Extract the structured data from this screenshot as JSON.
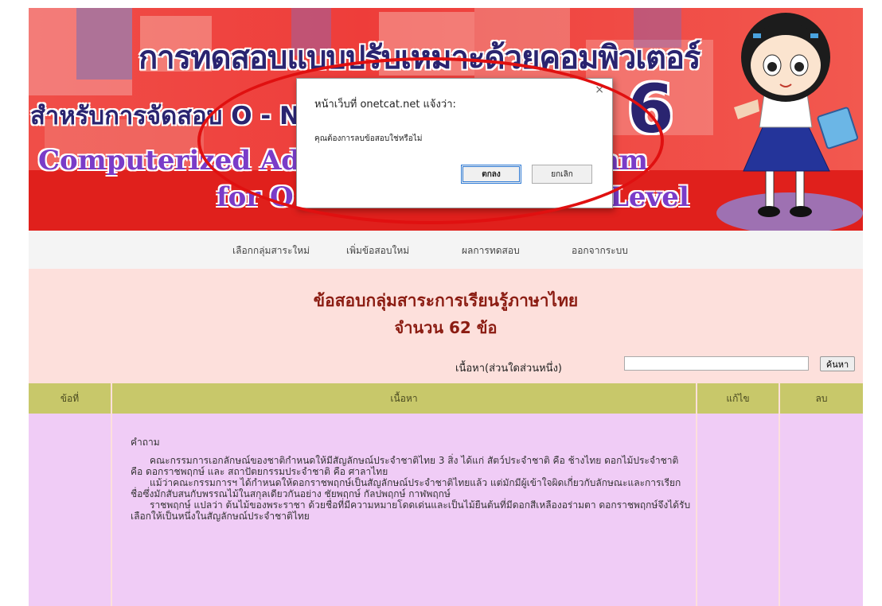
{
  "banner": {
    "title_th": "การทดสอบแบบปรับเหมาะด้วยคอมพิวเตอร์",
    "subtitle_th": "สำหรับการจัดสอบ O - N",
    "grade_number": "6",
    "english_line1_start": "Computerized Ad",
    "english_line1_end": "am",
    "english_line2_start": "for O",
    "english_line2_end": "Level"
  },
  "nav": {
    "items": [
      "เลือกกลุ่มสาระใหม่",
      "เพิ่มข้อสอบใหม่",
      "ผลการทดสอบ",
      "ออกจากระบบ"
    ]
  },
  "main": {
    "heading": "ข้อสอบกลุ่มสาระการเรียนรู้ภาษาไทย",
    "count_line": "จำนวน 62 ข้อ",
    "search_label": "เนื้อหา(ส่วนใดส่วนหนึ่ง)",
    "search_value": "",
    "search_button": "ค้นหา"
  },
  "table": {
    "headers": [
      "ข้อที่",
      "เนื้อหา",
      "แก้ไข",
      "ลบ"
    ],
    "row": {
      "title": "คำถาม",
      "paragraphs": [
        "คณะกรรมการเอกลักษณ์ของชาติกำหนดให้มีสัญลักษณ์ประจำชาติไทย 3 สิ่ง ได้แก่ สัตว์ประจำชาติ คือ ช้างไทย ดอกไม้ประจำชาติ คือ ดอกราชพฤกษ์ และ สถาปัตยกรรมประจำชาติ คือ ศาลาไทย",
        "แม้ว่าคณะกรรมการฯ ได้กำหนดให้ดอกราชพฤกษ์เป็นสัญลักษณ์ประจำชาติไทยแล้ว แต่มักมีผู้เข้าใจผิดเกี่ยวกับลักษณะและการเรียกชื่อซึ่งมักสับสนกับพรรณไม้ในสกุลเดียวกันอย่าง ชัยพฤกษ์ กัลปพฤกษ์ กาฬพฤกษ์",
        "ราชพฤกษ์ แปลว่า ต้นไม้ของพระราชา ด้วยชื่อที่มีความหมายโดดเด่นและเป็นไม้ยืนต้นที่มีดอกสีเหลืองอร่ามตา ดอกราชพฤกษ์จึงได้รับเลือกให้เป็นหนึ่งในสัญลักษณ์ประจำชาติไทย"
      ]
    }
  },
  "dialog": {
    "title": "หน้าเว็บที่ onetcat.net แจ้งว่า:",
    "message": "คุณต้องการลบข้อสอบใช่หรือไม่",
    "ok_label": "ตกลง",
    "cancel_label": "ยกเลิก",
    "close_symbol": "×"
  },
  "colors": {
    "banner_red": "#ee3d3a",
    "title_navy": "#2a2470",
    "english_purple": "#7a3cc8",
    "content_bg": "#fde0dc",
    "table_header": "#c8c86a",
    "row_bg": "#f0ccf6",
    "annotation_red": "#e01010"
  }
}
